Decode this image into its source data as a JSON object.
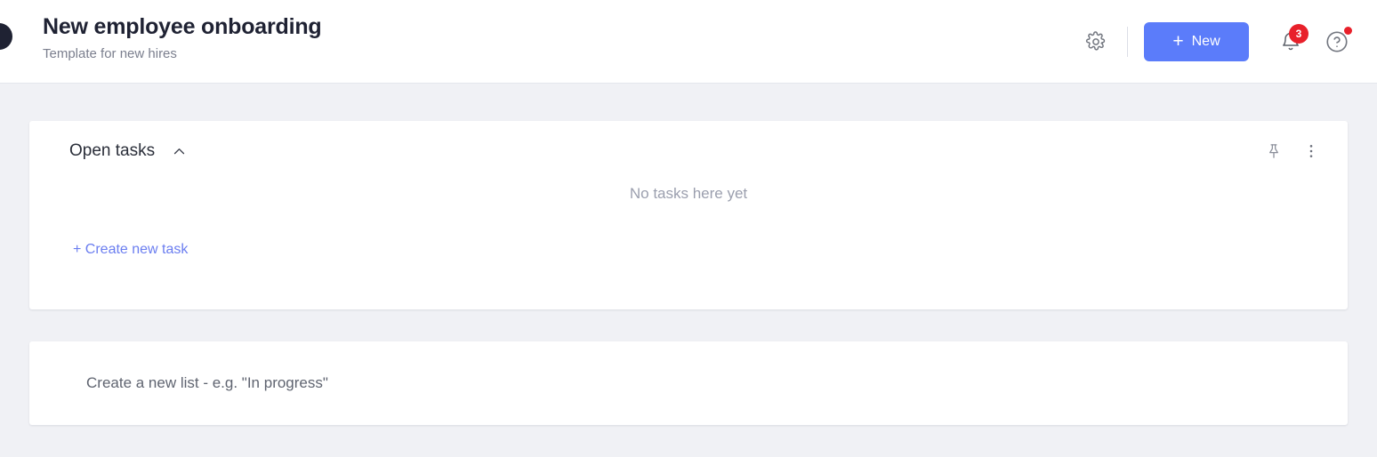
{
  "header": {
    "title": "New employee onboarding",
    "subtitle": "Template for new hires",
    "settings_icon": "gear-icon",
    "new_button": {
      "plus": "+",
      "label": "New"
    },
    "notifications": {
      "icon": "bell-icon",
      "count": "3"
    },
    "help": {
      "icon": "question-circle-icon",
      "has_dot": true
    },
    "sidebar_toggle_icon": "sidebar-toggle-circle-icon"
  },
  "lists": {
    "open_tasks": {
      "title": "Open tasks",
      "collapse_icon": "chevron-up-icon",
      "pin_icon": "pin-icon",
      "more_icon": "more-vertical-icon",
      "empty_text": "No tasks here yet",
      "create_task_label": "+ Create new task"
    },
    "new_list": {
      "placeholder": "Create a new list - e.g. \"In progress\""
    }
  },
  "colors": {
    "accent_blue": "#5b7cfa",
    "link_blue": "#6b7ef0",
    "badge_red": "#e8202a",
    "page_background": "#f0f1f5",
    "card_background": "#ffffff",
    "title_text": "#1f2233",
    "muted_text": "#9b9fae"
  }
}
